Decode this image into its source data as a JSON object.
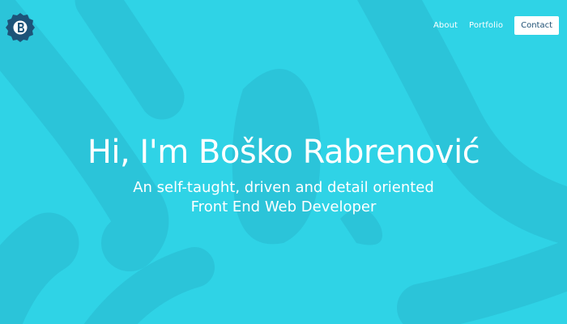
{
  "nav": {
    "logo_icon": "b-logo-icon",
    "links": [
      {
        "label": "About"
      },
      {
        "label": "Portfolio"
      }
    ],
    "contact_label": "Contact"
  },
  "hero": {
    "title": "Hi, I'm Boško Rabrenović",
    "subtitle_line1": "An self-taught, driven and detail oriented",
    "subtitle_line2": "Front End Web Developer"
  },
  "colors": {
    "background": "#2fd3e6",
    "background_shapes": "#2cc8dc",
    "logo_dark": "#1d5378",
    "contact_text": "#1d4f73"
  }
}
